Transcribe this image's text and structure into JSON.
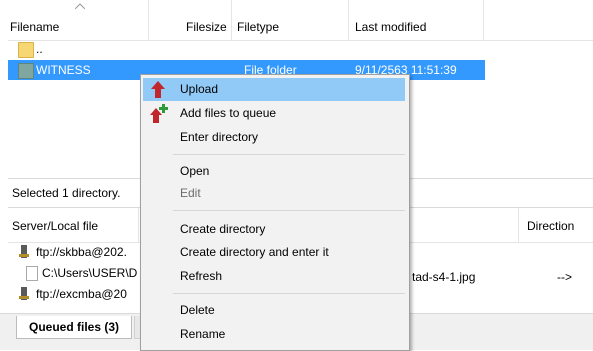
{
  "file_list": {
    "columns": [
      "Filename",
      "Filesize",
      "Filetype",
      "Last modified"
    ],
    "rows": [
      {
        "name": "..",
        "size": "",
        "type": "",
        "modified": ""
      },
      {
        "name": "WITNESS",
        "size": "",
        "type": "File folder",
        "modified": "9/11/2563 11:51:39"
      }
    ]
  },
  "status": {
    "text": "Selected 1 directory."
  },
  "queue": {
    "columns": [
      "Server/Local file",
      "Direction"
    ],
    "rows": [
      {
        "server": "ftp://skbba@202.",
        "remote": "",
        "direction": ""
      },
      {
        "server": "C:\\Users\\USER\\D",
        "remote": "tad-s4-1.jpg",
        "direction": "-->"
      },
      {
        "server": "ftp://excmba@20",
        "remote": "",
        "direction": ""
      }
    ]
  },
  "tabs": {
    "queued_files": "Queued files (3)"
  },
  "context_menu": {
    "items": [
      {
        "label": "Upload",
        "icon": "upload-icon"
      },
      {
        "label": "Add files to queue",
        "icon": "add-to-queue-icon"
      },
      {
        "label": "Enter directory"
      },
      {
        "label": "Open"
      },
      {
        "label": "Edit"
      },
      {
        "label": "Create directory"
      },
      {
        "label": "Create directory and enter it"
      },
      {
        "label": "Refresh"
      },
      {
        "label": "Delete"
      },
      {
        "label": "Rename"
      }
    ]
  },
  "colors": {
    "selection": "#3399ff",
    "menu_highlight": "#91c9f7",
    "folder": "#f7d774",
    "folder_selected": "#7fa7a0",
    "upload_arrow": "#c0262b",
    "add_plus": "#2e9b3a"
  }
}
